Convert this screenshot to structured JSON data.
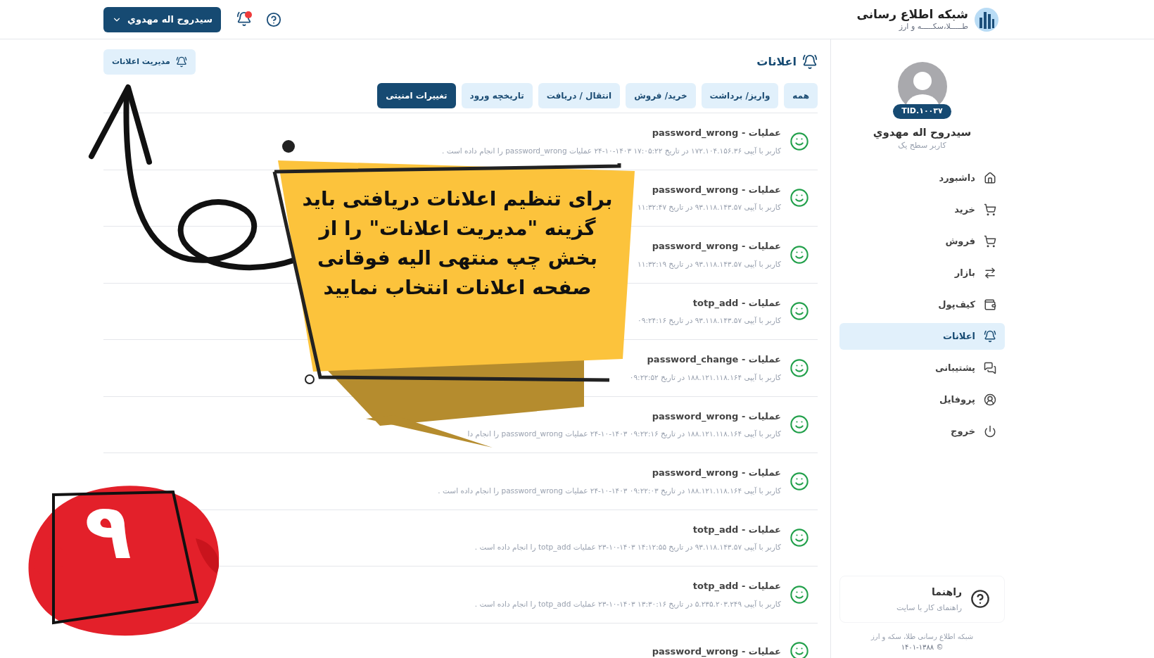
{
  "header": {
    "logo": {
      "title": "شبکه اطلاع رسانی",
      "subtitle": "طـــــلا،سکـــــه و ارز"
    },
    "user_button": "سیدروح اله مهدوي",
    "has_unread": true
  },
  "sidebar": {
    "profile": {
      "id": "TID.۱۰۰۳۷",
      "name": "سیدروح اله مهدوي",
      "role": "کاربر سطح یک"
    },
    "items": [
      {
        "label": "داشبورد",
        "selected": false
      },
      {
        "label": "خرید",
        "selected": false
      },
      {
        "label": "فروش",
        "selected": false
      },
      {
        "label": "بازار",
        "selected": false
      },
      {
        "label": "کیف‌پول",
        "selected": false
      },
      {
        "label": "اعلانات",
        "selected": true
      },
      {
        "label": "پشتیبانی",
        "selected": false
      },
      {
        "label": "پروفایل",
        "selected": false
      },
      {
        "label": "خروج",
        "selected": false
      }
    ],
    "help": {
      "title": "راهنما",
      "subtitle": "راهنمای کار با سایت"
    },
    "footer": {
      "text": "شبکه اطلاع رسانی طلا، سکه و ارز",
      "copyright": "© ۱۴۰۱-۱۳۸۸"
    }
  },
  "main": {
    "title": "اعلانات",
    "manage_button": "مدیریت اعلانات",
    "tabs": [
      {
        "label": "همه",
        "selected": false
      },
      {
        "label": "واریز/ برداشت",
        "selected": false
      },
      {
        "label": "خرید/ فروش",
        "selected": false
      },
      {
        "label": "انتقال / دریافت",
        "selected": false
      },
      {
        "label": "تاریخچه ورود",
        "selected": false
      },
      {
        "label": "تغییرات امنیتی",
        "selected": true
      }
    ],
    "notifications": [
      {
        "title": "عملیات - password_wrong",
        "description": "کاربر با آیپی ۱۷۲.۱۰۴.۱۵۶.۳۶ در تاریخ ۱۷:۰۵:۲۲ ۱۴۰۳-۱۰-۲۴ عملیات password_wrong را انجام داده است ."
      },
      {
        "title": "عملیات - password_wrong",
        "description": "کاربر با آیپی ۹۳.۱۱۸.۱۴۳.۵۷ در تاریخ ۱۱:۳۲:۴۷"
      },
      {
        "title": "عملیات - password_wrong",
        "description": "کاربر با آیپی ۹۳.۱۱۸.۱۴۳.۵۷ در تاریخ ۱۱:۳۲:۱۹"
      },
      {
        "title": "عملیات - totp_add",
        "description": "کاربر با آیپی ۹۳.۱۱۸.۱۴۳.۵۷ در تاریخ ۰۹:۲۴:۱۶"
      },
      {
        "title": "عملیات - password_change",
        "description": "کاربر با آیپی ۱۸۸.۱۲۱.۱۱۸.۱۶۴ در تاریخ ۰۹:۲۲:۵۲"
      },
      {
        "title": "عملیات - password_wrong",
        "description": "کاربر با آیپی ۱۸۸.۱۲۱.۱۱۸.۱۶۴ در تاریخ ۰۹:۲۲:۱۶ ۱۴۰۳-۱۰-۲۴ عملیات password_wrong را انجام دا"
      },
      {
        "title": "عملیات - password_wrong",
        "description": "کاربر با آیپی ۱۸۸.۱۲۱.۱۱۸.۱۶۴ در تاریخ ۰۹:۲۲:۰۳ ۱۴۰۳-۱۰-۲۴ عملیات password_wrong را انجام داده است ."
      },
      {
        "title": "عملیات - totp_add",
        "description": "کاربر با آیپی ۹۳.۱۱۸.۱۴۳.۵۷ در تاریخ ۱۴:۱۲:۵۵ ۱۴۰۳-۱۰-۲۳ عملیات totp_add را انجام داده است ."
      },
      {
        "title": "عملیات - totp_add",
        "description": "کاربر با آیپی ۵.۲۳۵.۲۰۳.۲۴۹ در تاریخ ۱۳:۳۰:۱۶ ۱۴۰۳-۱۰-۲۳ عملیات totp_add را انجام داده است ."
      },
      {
        "title": "عملیات - password_wrong"
      }
    ]
  },
  "annotation": {
    "lines": [
      "برای تنظیم اعلانات دریافتی باید",
      "گزینه \"مدیریت اعلانات\" را از",
      "بخش چپ منتهی الیه فوقانی",
      "صفحه اعلانات انتخاب نمایید"
    ],
    "step": "۹"
  }
}
